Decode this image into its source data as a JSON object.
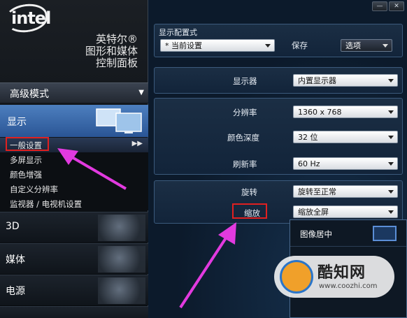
{
  "brand": {
    "logo_text": "intel",
    "product_lines": [
      "英特尔®",
      "图形和媒体",
      "控制面板"
    ]
  },
  "mode_selector": {
    "label": "高级模式"
  },
  "sidebar": {
    "display_label": "显示",
    "sub_items": [
      "一般设置",
      "多屏显示",
      "颜色增强",
      "自定义分辨率",
      "监视器 / 电视机设置"
    ],
    "active_index": 0,
    "categories": [
      "3D",
      "媒体",
      "电源"
    ]
  },
  "window_controls": {
    "minimize": "—",
    "close": "✕"
  },
  "profile": {
    "title": "显示配置式",
    "current": "* 当前设置",
    "save_label": "保存",
    "options_label": "选项"
  },
  "monitor": {
    "label": "显示器",
    "value": "内置显示器"
  },
  "settings": [
    {
      "label": "分辨率",
      "value": "1360 x 768"
    },
    {
      "label": "颜色深度",
      "value": "32 位"
    },
    {
      "label": "刷新率",
      "value": "60 Hz"
    }
  ],
  "rotation": {
    "label": "旋转",
    "value": "旋转至正常"
  },
  "scaling": {
    "label": "缩放",
    "value": "缩放全屏",
    "options": [
      "图像居中"
    ]
  },
  "watermark": {
    "name": "酷知网",
    "url": "www.coozhi.com"
  },
  "colors": {
    "accent": "#4d7fbf",
    "highlight_box": "#e02020",
    "arrow": "#e23adf"
  }
}
